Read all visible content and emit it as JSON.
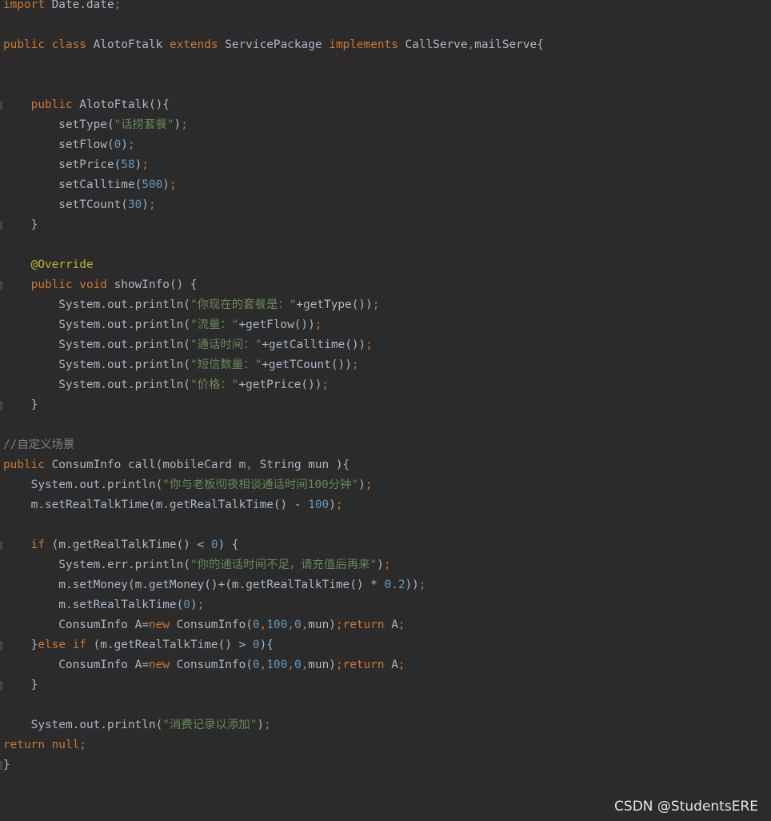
{
  "editor": {
    "lines": [
      [
        {
          "t": "kw",
          "v": "import"
        },
        {
          "t": "plain",
          "v": " Date.date"
        },
        {
          "t": "kw",
          "v": ";"
        }
      ],
      [],
      [
        {
          "t": "kw",
          "v": "public class"
        },
        {
          "t": "plain",
          "v": " AlotoFtalk "
        },
        {
          "t": "kw",
          "v": "extends"
        },
        {
          "t": "plain",
          "v": " ServicePackage "
        },
        {
          "t": "kw",
          "v": "implements"
        },
        {
          "t": "plain",
          "v": " CallServe"
        },
        {
          "t": "kw",
          "v": ","
        },
        {
          "t": "plain",
          "v": "mailServe{"
        }
      ],
      [],
      [],
      [
        {
          "t": "plain",
          "v": "    "
        },
        {
          "t": "kw",
          "v": "public"
        },
        {
          "t": "plain",
          "v": " AlotoFtalk(){"
        }
      ],
      [
        {
          "t": "plain",
          "v": "        setType("
        },
        {
          "t": "str",
          "v": "\"话捞套餐\""
        },
        {
          "t": "plain",
          "v": ")"
        },
        {
          "t": "kw",
          "v": ";"
        }
      ],
      [
        {
          "t": "plain",
          "v": "        setFlow("
        },
        {
          "t": "num",
          "v": "0"
        },
        {
          "t": "plain",
          "v": ")"
        },
        {
          "t": "kw",
          "v": ";"
        }
      ],
      [
        {
          "t": "plain",
          "v": "        setPrice("
        },
        {
          "t": "num",
          "v": "58"
        },
        {
          "t": "plain",
          "v": ")"
        },
        {
          "t": "kw",
          "v": ";"
        }
      ],
      [
        {
          "t": "plain",
          "v": "        setCalltime("
        },
        {
          "t": "num",
          "v": "500"
        },
        {
          "t": "plain",
          "v": ")"
        },
        {
          "t": "kw",
          "v": ";"
        }
      ],
      [
        {
          "t": "plain",
          "v": "        setTCount("
        },
        {
          "t": "num",
          "v": "30"
        },
        {
          "t": "plain",
          "v": ")"
        },
        {
          "t": "kw",
          "v": ";"
        }
      ],
      [
        {
          "t": "plain",
          "v": "    }"
        }
      ],
      [],
      [
        {
          "t": "plain",
          "v": "    "
        },
        {
          "t": "ann",
          "v": "@Override"
        }
      ],
      [
        {
          "t": "plain",
          "v": "    "
        },
        {
          "t": "kw",
          "v": "public void"
        },
        {
          "t": "plain",
          "v": " showInfo() {"
        }
      ],
      [
        {
          "t": "plain",
          "v": "        System."
        },
        {
          "t": "plain",
          "v": "out"
        },
        {
          "t": "plain",
          "v": ".println("
        },
        {
          "t": "str",
          "v": "\"你现在的套餐是：\""
        },
        {
          "t": "plain",
          "v": "+getType())"
        },
        {
          "t": "kw",
          "v": ";"
        }
      ],
      [
        {
          "t": "plain",
          "v": "        System."
        },
        {
          "t": "plain",
          "v": "out"
        },
        {
          "t": "plain",
          "v": ".println("
        },
        {
          "t": "str",
          "v": "\"流量：\""
        },
        {
          "t": "plain",
          "v": "+getFlow())"
        },
        {
          "t": "kw",
          "v": ";"
        }
      ],
      [
        {
          "t": "plain",
          "v": "        System."
        },
        {
          "t": "plain",
          "v": "out"
        },
        {
          "t": "plain",
          "v": ".println("
        },
        {
          "t": "str",
          "v": "\"通话时间：\""
        },
        {
          "t": "plain",
          "v": "+getCalltime())"
        },
        {
          "t": "kw",
          "v": ";"
        }
      ],
      [
        {
          "t": "plain",
          "v": "        System."
        },
        {
          "t": "plain",
          "v": "out"
        },
        {
          "t": "plain",
          "v": ".println("
        },
        {
          "t": "str",
          "v": "\"短信数量：\""
        },
        {
          "t": "plain",
          "v": "+getTCount())"
        },
        {
          "t": "kw",
          "v": ";"
        }
      ],
      [
        {
          "t": "plain",
          "v": "        System."
        },
        {
          "t": "plain",
          "v": "out"
        },
        {
          "t": "plain",
          "v": ".println("
        },
        {
          "t": "str",
          "v": "\"价格：\""
        },
        {
          "t": "plain",
          "v": "+getPrice())"
        },
        {
          "t": "kw",
          "v": ";"
        }
      ],
      [
        {
          "t": "plain",
          "v": "    }"
        }
      ],
      [],
      [
        {
          "t": "cmt",
          "v": "//自定义场景"
        }
      ],
      [
        {
          "t": "kw",
          "v": "public"
        },
        {
          "t": "plain",
          "v": " ConsumInfo call(mobileCard m"
        },
        {
          "t": "kw",
          "v": ","
        },
        {
          "t": "plain",
          "v": " String mun ){"
        }
      ],
      [
        {
          "t": "plain",
          "v": "    System."
        },
        {
          "t": "plain",
          "v": "out"
        },
        {
          "t": "plain",
          "v": ".println("
        },
        {
          "t": "str",
          "v": "\"你与老板彻夜相谈通话时间100分钟\""
        },
        {
          "t": "plain",
          "v": ")"
        },
        {
          "t": "kw",
          "v": ";"
        }
      ],
      [
        {
          "t": "plain",
          "v": "    m.setRealTalkTime(m.getRealTalkTime() - "
        },
        {
          "t": "num",
          "v": "100"
        },
        {
          "t": "plain",
          "v": ")"
        },
        {
          "t": "kw",
          "v": ";"
        }
      ],
      [],
      [
        {
          "t": "plain",
          "v": "    "
        },
        {
          "t": "kw",
          "v": "if"
        },
        {
          "t": "plain",
          "v": " (m.getRealTalkTime() < "
        },
        {
          "t": "num",
          "v": "0"
        },
        {
          "t": "plain",
          "v": ") {"
        }
      ],
      [
        {
          "t": "plain",
          "v": "        System."
        },
        {
          "t": "plain",
          "v": "err"
        },
        {
          "t": "plain",
          "v": ".println("
        },
        {
          "t": "str",
          "v": "\"你的通话时间不足，请充值后再来\""
        },
        {
          "t": "plain",
          "v": ")"
        },
        {
          "t": "kw",
          "v": ";"
        }
      ],
      [
        {
          "t": "plain",
          "v": "        m.setMoney(m.getMoney()+(m.getRealTalkTime() * "
        },
        {
          "t": "num",
          "v": "0.2"
        },
        {
          "t": "plain",
          "v": "))"
        },
        {
          "t": "kw",
          "v": ";"
        }
      ],
      [
        {
          "t": "plain",
          "v": "        m.setRealTalkTime("
        },
        {
          "t": "num",
          "v": "0"
        },
        {
          "t": "plain",
          "v": ")"
        },
        {
          "t": "kw",
          "v": ";"
        }
      ],
      [
        {
          "t": "plain",
          "v": "        ConsumInfo A="
        },
        {
          "t": "kw",
          "v": "new"
        },
        {
          "t": "plain",
          "v": " ConsumInfo("
        },
        {
          "t": "num",
          "v": "0"
        },
        {
          "t": "kw",
          "v": ","
        },
        {
          "t": "num",
          "v": "100"
        },
        {
          "t": "kw",
          "v": ","
        },
        {
          "t": "num",
          "v": "0"
        },
        {
          "t": "kw",
          "v": ","
        },
        {
          "t": "plain",
          "v": "mun)"
        },
        {
          "t": "kw",
          "v": ";return"
        },
        {
          "t": "plain",
          "v": " A"
        },
        {
          "t": "kw",
          "v": ";"
        }
      ],
      [
        {
          "t": "plain",
          "v": "    }"
        },
        {
          "t": "kw",
          "v": "else if"
        },
        {
          "t": "plain",
          "v": " (m.getRealTalkTime() > "
        },
        {
          "t": "num",
          "v": "0"
        },
        {
          "t": "plain",
          "v": "){"
        }
      ],
      [
        {
          "t": "plain",
          "v": "        ConsumInfo A="
        },
        {
          "t": "kw",
          "v": "new"
        },
        {
          "t": "plain",
          "v": " ConsumInfo("
        },
        {
          "t": "num",
          "v": "0"
        },
        {
          "t": "kw",
          "v": ","
        },
        {
          "t": "num",
          "v": "100"
        },
        {
          "t": "kw",
          "v": ","
        },
        {
          "t": "num",
          "v": "0"
        },
        {
          "t": "kw",
          "v": ","
        },
        {
          "t": "plain",
          "v": "mun)"
        },
        {
          "t": "kw",
          "v": ";return"
        },
        {
          "t": "plain",
          "v": " A"
        },
        {
          "t": "kw",
          "v": ";"
        }
      ],
      [
        {
          "t": "plain",
          "v": "    }"
        }
      ],
      [],
      [
        {
          "t": "plain",
          "v": "    System."
        },
        {
          "t": "plain",
          "v": "out"
        },
        {
          "t": "plain",
          "v": ".println("
        },
        {
          "t": "str",
          "v": "\"消费记录以添加\""
        },
        {
          "t": "plain",
          "v": ")"
        },
        {
          "t": "kw",
          "v": ";"
        }
      ],
      [
        {
          "t": "kw",
          "v": "return null;"
        }
      ],
      [
        {
          "t": "plain",
          "v": "}"
        }
      ]
    ],
    "gutter_marks": [
      5,
      11,
      14,
      20,
      27,
      32,
      34,
      38
    ]
  },
  "watermark": {
    "text": "CSDN @StudentsERE"
  },
  "colors": {
    "background": "#2b2b2b",
    "keyword": "#cc7832",
    "string": "#6a8759",
    "number": "#6897bb",
    "annotation": "#bbb529",
    "comment": "#808080",
    "plain": "#a9b7c6"
  }
}
